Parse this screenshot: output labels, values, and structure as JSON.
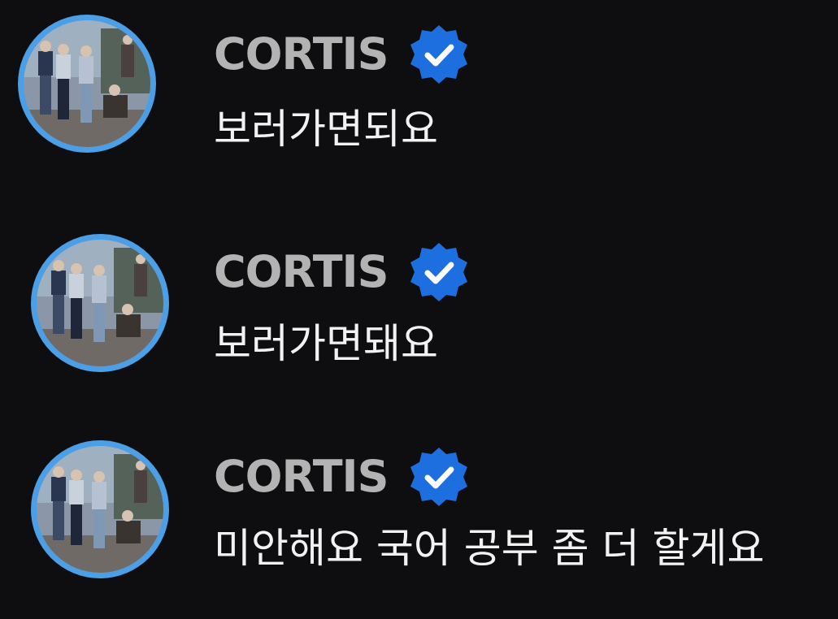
{
  "colors": {
    "background": "#0e0e10",
    "avatar_ring": "#4a9fe6",
    "username": "#b3b3b3",
    "message_text": "#f2f2f2",
    "verified_badge": "#1d6fe0"
  },
  "messages": [
    {
      "username": "CORTIS",
      "badge_icon": "verified-badge-icon",
      "text": "보러가면되요"
    },
    {
      "username": "CORTIS",
      "badge_icon": "verified-badge-icon",
      "text": "보러가면돼요"
    },
    {
      "username": "CORTIS",
      "badge_icon": "verified-badge-icon",
      "text": "미안해요 국어 공부 좀 더 할게요"
    }
  ]
}
